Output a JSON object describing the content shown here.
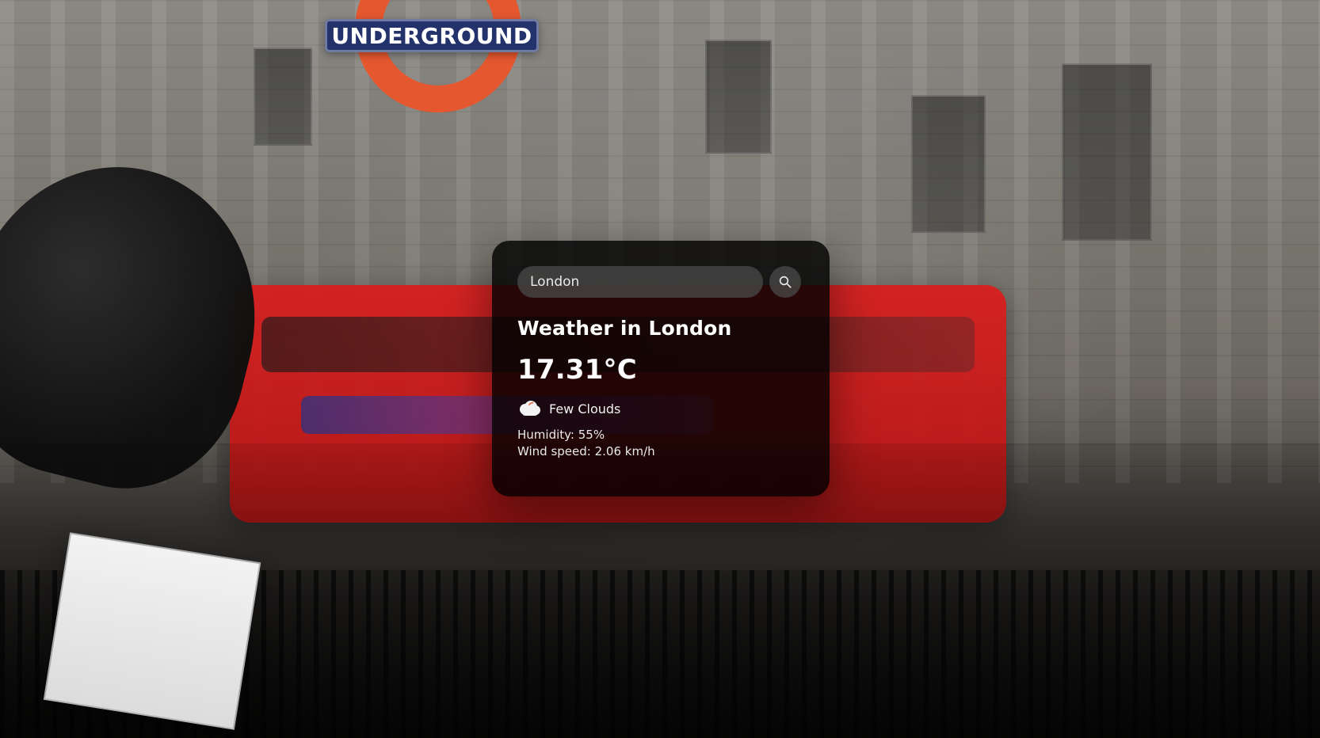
{
  "background": {
    "sign_text": "UNDERGROUND",
    "accent_red": "#d81f1f",
    "accent_orange": "#e5572f",
    "accent_navy": "#24326c"
  },
  "search": {
    "value": "London",
    "placeholder": ""
  },
  "weather": {
    "title": "Weather in London",
    "temperature": "17.31°C",
    "description": "Few Clouds",
    "humidity": "Humidity: 55%",
    "wind": "Wind speed: 2.06 km/h",
    "icon": "cloud-icon"
  },
  "colors": {
    "card_bg": "#000000",
    "card_text": "#ffffff",
    "input_bg": "#4b4b4b"
  }
}
